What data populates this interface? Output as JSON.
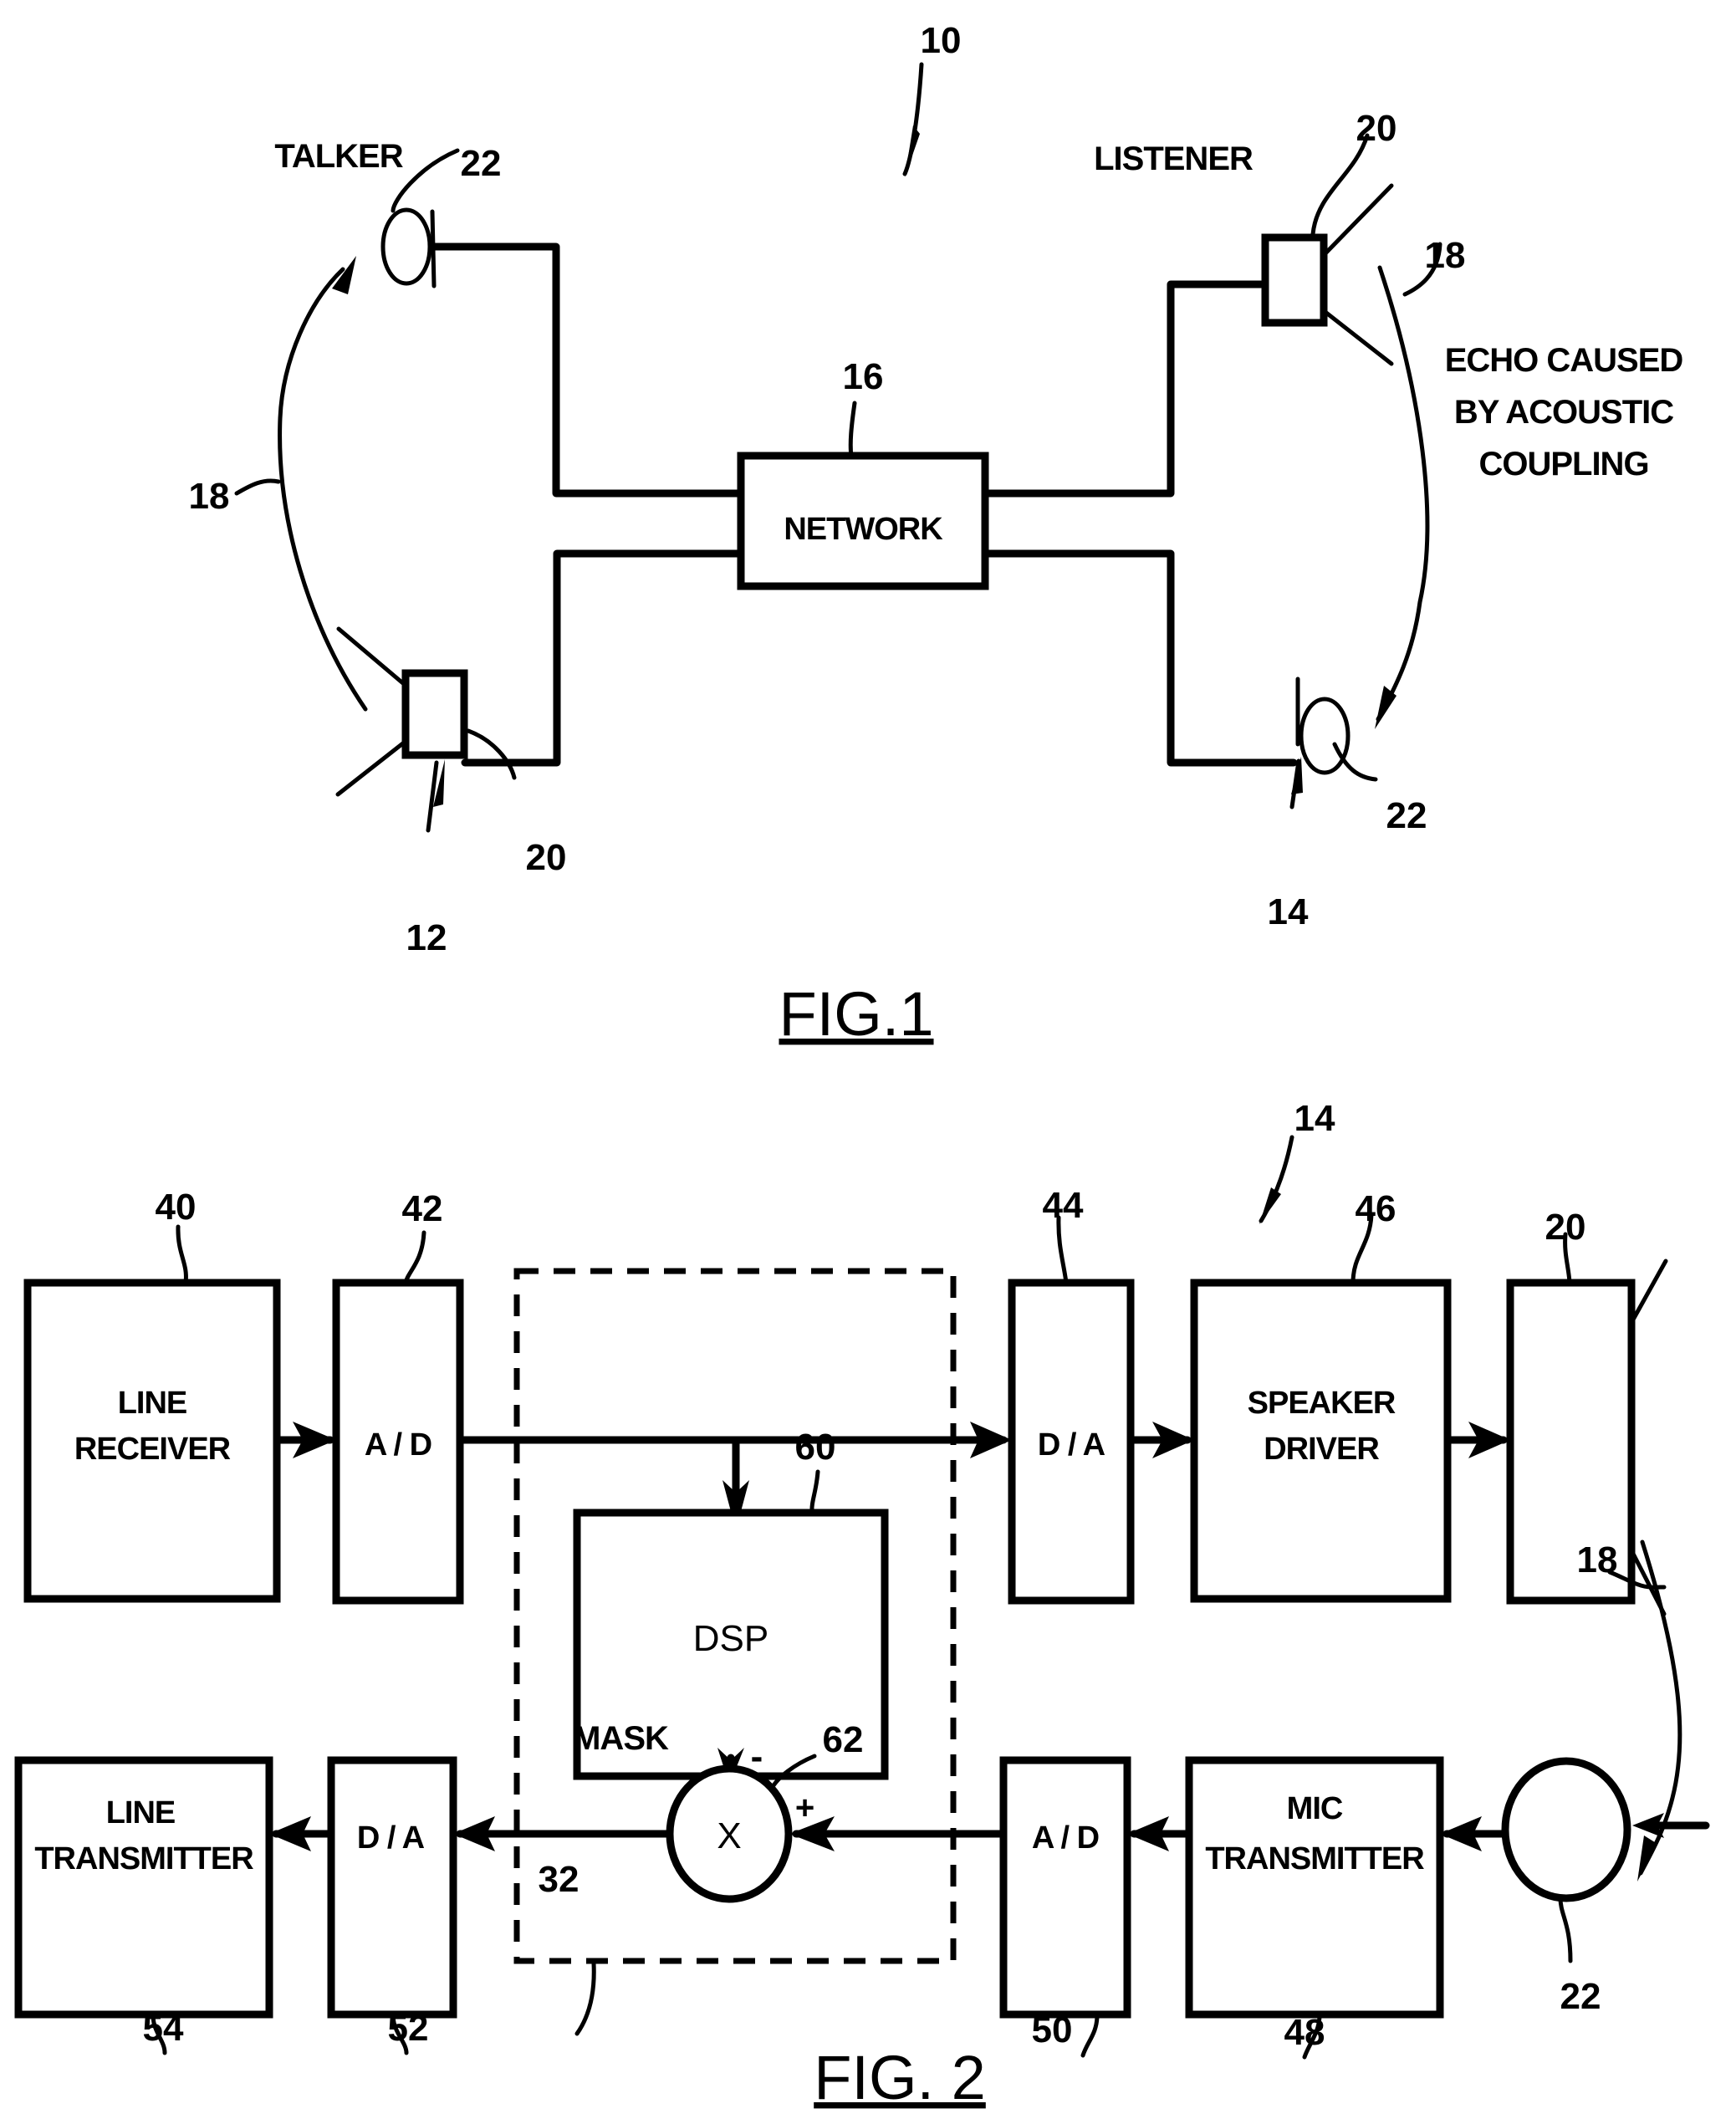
{
  "figure1": {
    "title": "FIG.1",
    "system_ref": "10",
    "talker_label": "TALKER",
    "listener_label": "LISTENER",
    "network": {
      "label": "NETWORK",
      "ref": "16"
    },
    "talker_station": {
      "ref": "12",
      "speaker_ref": "20",
      "mic_ref": "22",
      "echo_ref": "18"
    },
    "listener_station": {
      "ref": "14",
      "speaker_ref": "20",
      "mic_ref": "22",
      "echo_ref": "18"
    },
    "echo_note_lines": [
      "ECHO CAUSED",
      "BY ACOUSTIC",
      "COUPLING"
    ]
  },
  "figure2": {
    "title": "FIG. 2",
    "station_ref": "14",
    "blocks": [
      {
        "id": "line-receiver",
        "lines": [
          "LINE",
          "RECEIVER"
        ],
        "ref": "40"
      },
      {
        "id": "ad-top",
        "lines": [
          "A / D"
        ],
        "ref": "42"
      },
      {
        "id": "da-top",
        "lines": [
          "D / A"
        ],
        "ref": "44"
      },
      {
        "id": "speaker-driver",
        "lines": [
          "SPEAKER",
          "DRIVER"
        ],
        "ref": "46"
      },
      {
        "id": "speaker",
        "lines": [],
        "ref": "20"
      },
      {
        "id": "dsp",
        "lines": [
          "DSP"
        ],
        "ref": "60"
      },
      {
        "id": "line-transmitter",
        "lines": [
          "LINE",
          "TRANSMITTER"
        ],
        "ref": "54"
      },
      {
        "id": "da-bottom",
        "lines": [
          "D / A"
        ],
        "ref": "52"
      },
      {
        "id": "ad-bottom",
        "lines": [
          "A / D"
        ],
        "ref": "50"
      },
      {
        "id": "mic-transmitter",
        "lines": [
          "MIC",
          "TRANSMITTER"
        ],
        "ref": "48"
      }
    ],
    "mixer": {
      "symbol": "X",
      "ref": "62",
      "minus": "-",
      "plus": "+"
    },
    "mask_label": "MASK",
    "mask_region_ref": "32",
    "mic_ref": "22",
    "echo_ref": "18"
  }
}
